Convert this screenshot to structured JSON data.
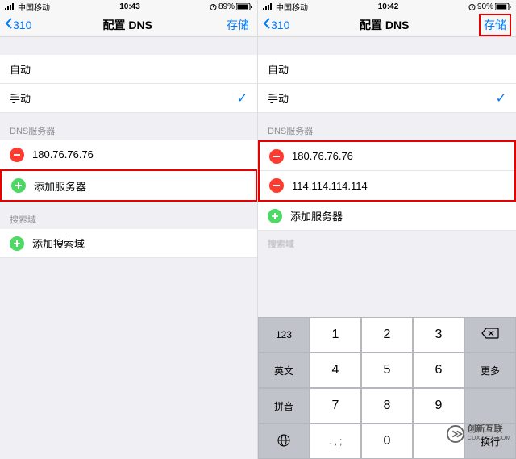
{
  "left": {
    "status": {
      "carrier": "中国移动",
      "time": "10:43",
      "battery": "89%"
    },
    "nav": {
      "back": "310",
      "title": "配置 DNS",
      "save": "存储"
    },
    "mode": {
      "auto": "自动",
      "manual": "手动"
    },
    "dns_header": "DNS服务器",
    "servers": [
      "180.76.76.76"
    ],
    "add_server": "添加服务器",
    "search_header": "搜索域",
    "add_search": "添加搜索域"
  },
  "right": {
    "status": {
      "carrier": "中国移动",
      "time": "10:42",
      "battery": "90%"
    },
    "nav": {
      "back": "310",
      "title": "配置 DNS",
      "save": "存储"
    },
    "mode": {
      "auto": "自动",
      "manual": "手动"
    },
    "dns_header": "DNS服务器",
    "servers": [
      "180.76.76.76",
      "114.114.114.114"
    ],
    "add_server": "添加服务器",
    "search_header_cut": "搜索域"
  },
  "keyboard": {
    "k123": "123",
    "k1": "1",
    "k2": "2",
    "k3": "3",
    "eng": "英文",
    "k4": "4",
    "k5": "5",
    "k6": "6",
    "more": "更多",
    "pinyin": "拼音",
    "k7": "7",
    "k8": "8",
    "k9": "9",
    "sym": ". , ;",
    "k0": "0",
    "enter": "换行"
  },
  "watermark": {
    "brand": "创新互联",
    "sub": "CDXWCX.COM"
  }
}
